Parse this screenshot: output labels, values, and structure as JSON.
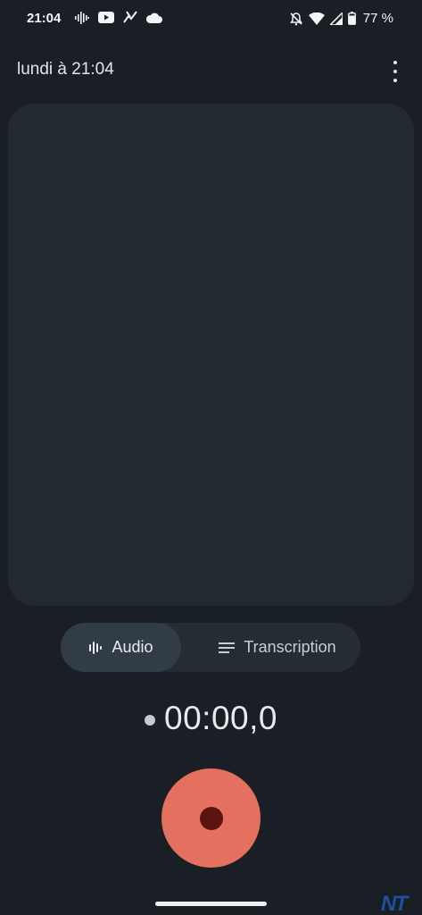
{
  "status_bar": {
    "time": "21:04",
    "battery_text": "77 %",
    "left_icons": [
      "waveform-icon",
      "youtube-icon",
      "messenger-icon",
      "cloud-icon"
    ],
    "right_icons": [
      "bell-off-icon",
      "wifi-icon",
      "signal-icon",
      "battery-icon"
    ]
  },
  "header": {
    "title": "lundi à 21:04",
    "more_icon": "more-vert-icon"
  },
  "view_toggle": {
    "audio_label": "Audio",
    "audio_icon": "waveform-icon",
    "transcription_label": "Transcription",
    "transcription_icon": "lines-icon",
    "selected": "Audio"
  },
  "recorder": {
    "timer": "00:00,0"
  },
  "watermark": {
    "text": "NT"
  },
  "colors": {
    "background": "#1a1f26",
    "panel": "#222a2f",
    "record_button": "#e4705f",
    "record_inner": "#5b1410",
    "toggle_selected": "#323c45"
  }
}
